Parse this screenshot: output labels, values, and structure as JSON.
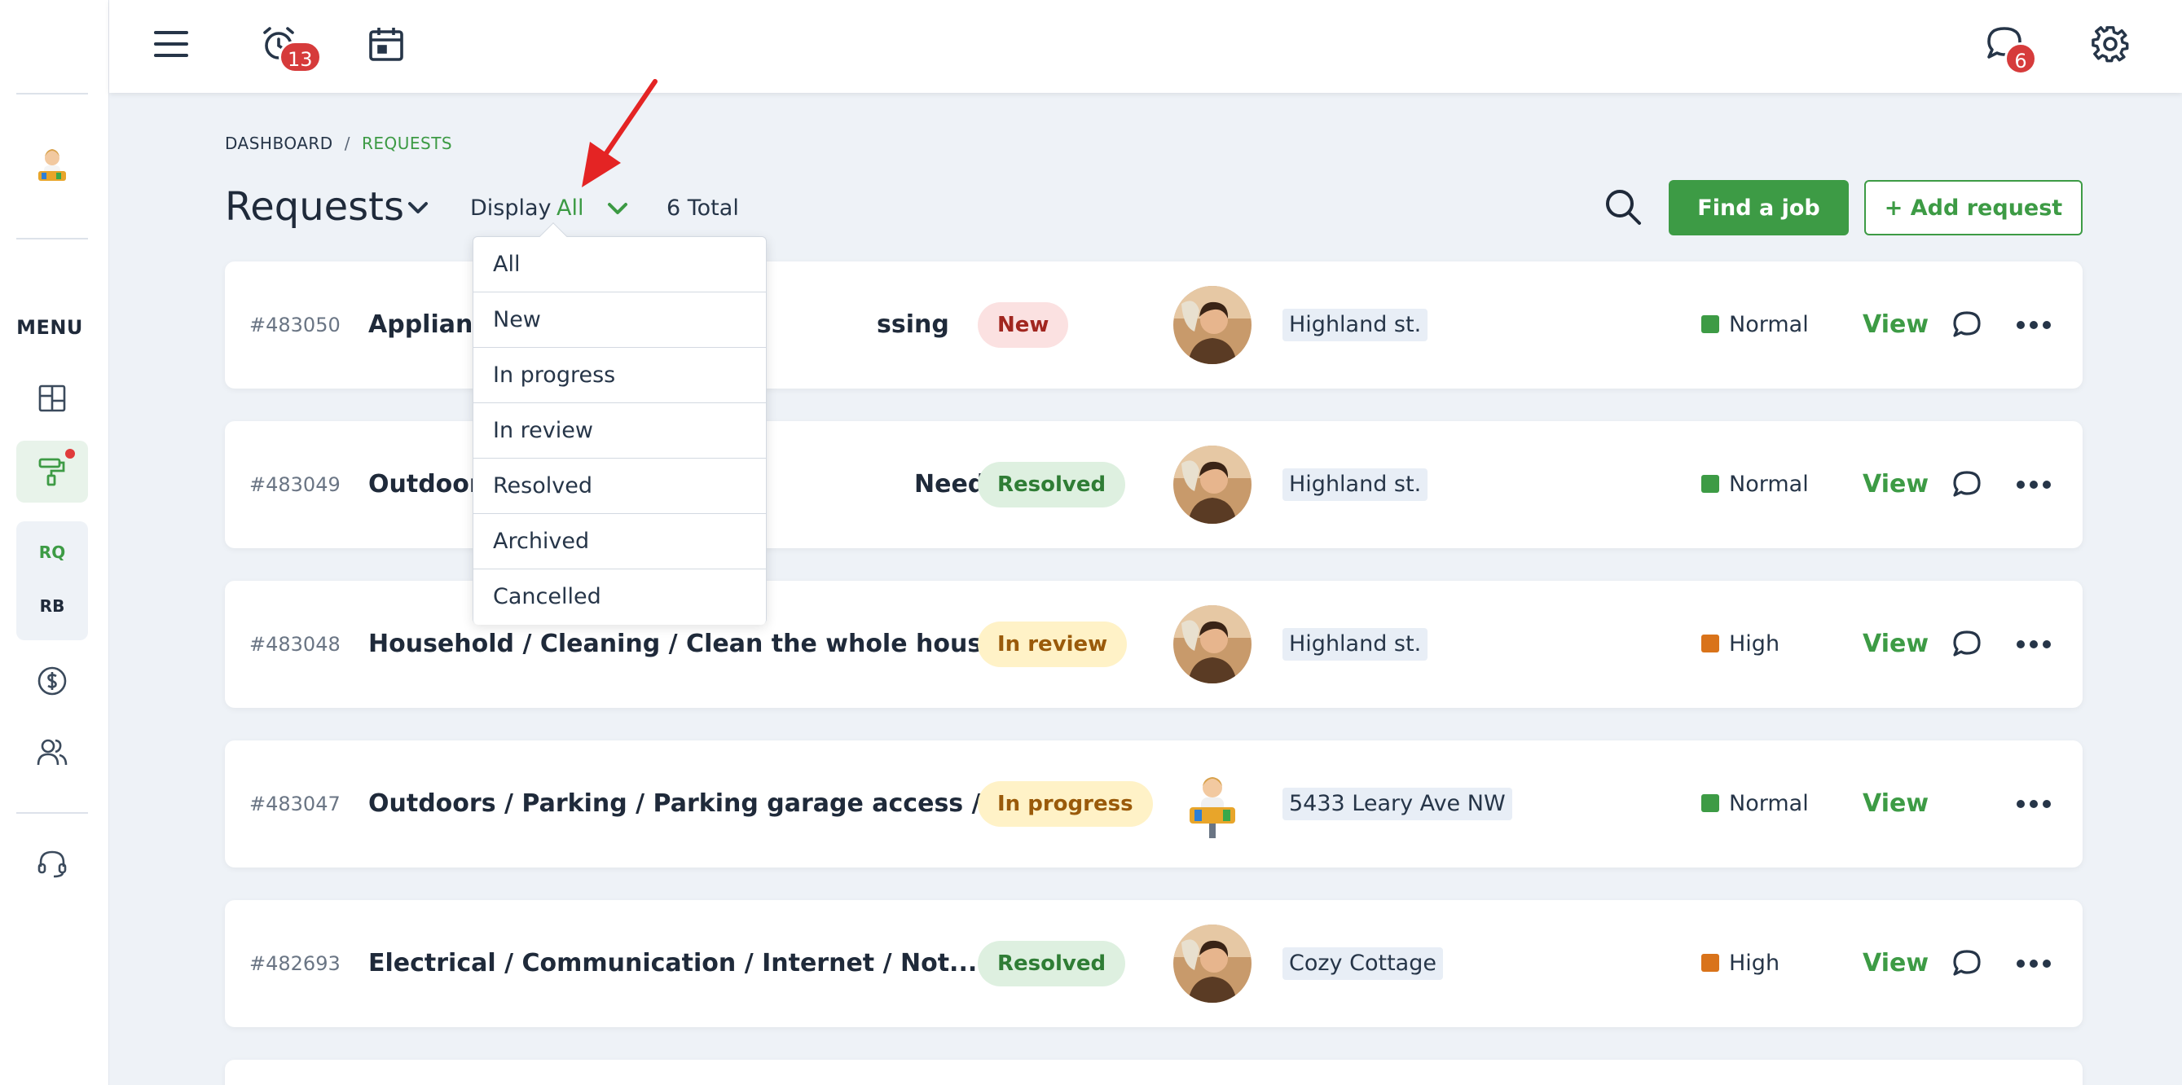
{
  "topbar": {
    "alarm_count": "13",
    "chat_count": "6",
    "icons": [
      "hamburger-menu-icon",
      "alarm-clock-icon",
      "calendar-icon",
      "chat-bubble-icon",
      "gear-icon"
    ]
  },
  "sidebar": {
    "menu_label": "MENU",
    "sub_items": [
      "RQ",
      "RB"
    ],
    "icons": [
      "dashboard-grid-icon",
      "paint-roller-icon",
      "dollar-circle-icon",
      "users-icon",
      "headset-icon"
    ]
  },
  "breadcrumb": {
    "root": "DASHBOARD",
    "separator": "/",
    "current": "REQUESTS"
  },
  "header": {
    "title": "Requests",
    "display_label": "Display",
    "display_value": "All",
    "total": "6 Total",
    "find_job": "Find a job",
    "add_request": "+ Add request"
  },
  "dropdown": {
    "options": [
      "All",
      "New",
      "In progress",
      "In review",
      "Resolved",
      "Archived",
      "Cancelled"
    ]
  },
  "rows": [
    {
      "id": "#483050",
      "title": "Appliance",
      "title_tail": "ssing",
      "status": "New",
      "location": "Highland st.",
      "priority": "Normal",
      "view": "View"
    },
    {
      "id": "#483049",
      "title": "Outdoors",
      "title_tail": "Need watering",
      "status": "Resolved",
      "location": "Highland st.",
      "priority": "Normal",
      "view": "View"
    },
    {
      "id": "#483048",
      "title": "Household / Cleaning / Clean the whole house",
      "status": "In review",
      "location": "Highland st.",
      "priority": "High",
      "view": "View"
    },
    {
      "id": "#483047",
      "title": "Outdoors / Parking / Parking garage access /...",
      "status": "In progress",
      "location": "5433 Leary Ave NW",
      "priority": "Normal",
      "view": "View"
    },
    {
      "id": "#482693",
      "title": "Electrical / Communication / Internet / Not...",
      "status": "Resolved",
      "location": "Cozy Cottage",
      "priority": "High",
      "view": "View"
    }
  ],
  "colors": {
    "accent": "#3d9b45",
    "normal": "#3d9b45",
    "high": "#d9731a",
    "badge": "#d63b3b"
  }
}
